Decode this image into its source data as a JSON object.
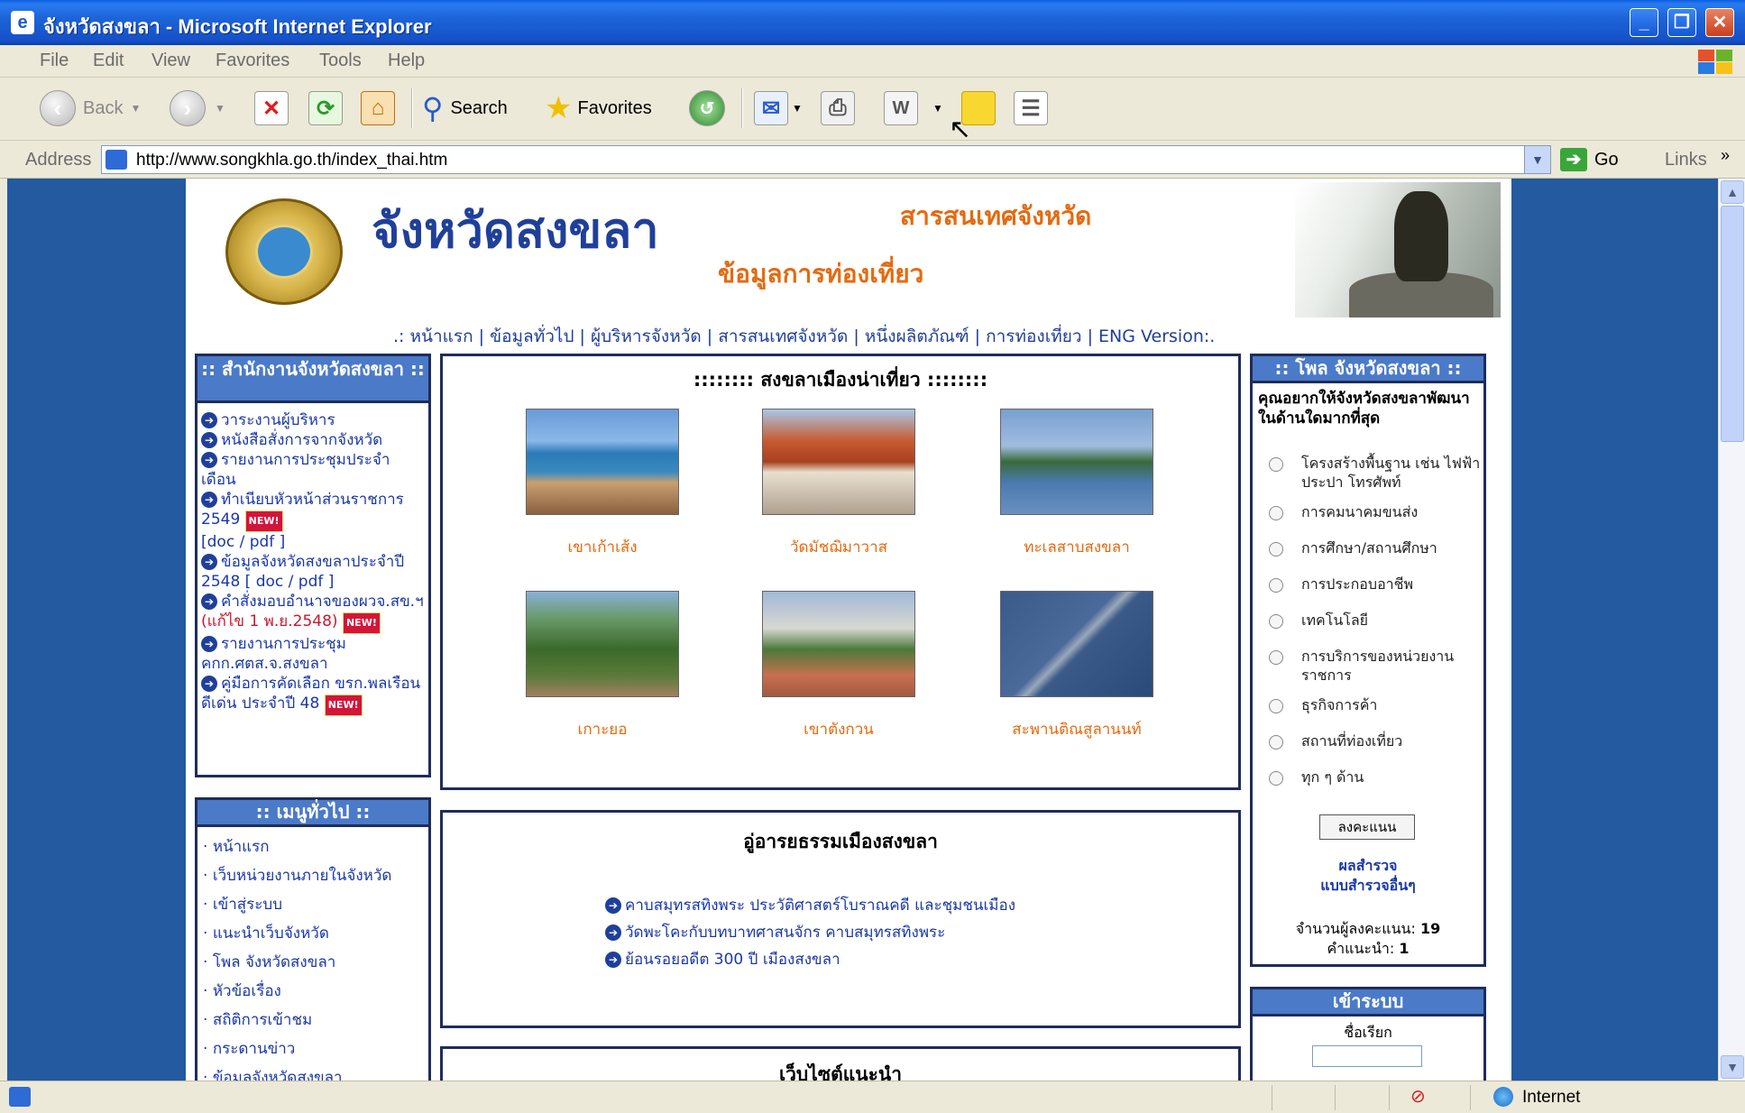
{
  "window": {
    "title": "จังหวัดสงขลา - Microsoft Internet Explorer"
  },
  "menu": [
    "File",
    "Edit",
    "View",
    "Favorites",
    "Tools",
    "Help"
  ],
  "toolbar": {
    "back_label": "Back",
    "search_label": "Search",
    "favorites_label": "Favorites"
  },
  "address": {
    "label": "Address",
    "url": "http://www.songkhla.go.th/index_thai.htm",
    "go_label": "Go",
    "links_label": "Links"
  },
  "header": {
    "site_title": "จังหวัดสงขลา",
    "subtitle1": "สารสนเทศจังหวัด",
    "subtitle2": "ข้อมูลการท่องเที่ยว"
  },
  "nav": {
    "prefix": ".:",
    "items": [
      "หน้าแรก",
      "ข้อมูลทั่วไป",
      "ผู้บริหารจังหวัด",
      "สารสนเทศจังหวัด",
      "หนึ่งผลิตภัณฑ์",
      "การท่องเที่ยว",
      "ENG Version"
    ],
    "suffix": ":."
  },
  "office_box": {
    "heading": ":: สำนักงานจังหวัดสงขลา ::",
    "links": [
      "วาระงานผู้บริหาร",
      "หนังสือสั่งการจากจังหวัด",
      "รายงานการประชุมประจำเดือน",
      "ทำเนียบหัวหน้าส่วนราชการ 2549",
      "[doc / pdf ]",
      "ข้อมูลจังหวัดสงขลาประจำปี 2548 [ doc / pdf ]",
      "คำสั่งมอบอำนาจของผวจ.สข.ฯ",
      "(แก้ไข 1 พ.ย.2548)",
      "รายงานการประชุม คกก.ศตส.จ.สงขลา",
      "คู่มือการคัดเลือก ขรก.พลเรือนดีเด่น ประจำปี 48"
    ],
    "new_badge": "NEW!"
  },
  "general_menu": {
    "heading": ":: เมนูทั่วไป ::",
    "items": [
      "หน้าแรก",
      "เว็บหน่วยงานภายในจังหวัด",
      "เข้าสู่ระบบ",
      "แนะนำเว็บจังหวัด",
      "โพล จังหวัดสงขลา",
      "หัวข้อเรื่อง",
      "สถิติการเข้าชม",
      "กระดานข่าว",
      "ข้อมูลจังหวัดสงขลา"
    ]
  },
  "tourism": {
    "heading": ":::::::: สงขลาเมืองน่าเที่ยว ::::::::",
    "places": [
      "เขาเก้าเส้ง",
      "วัดมัชฌิมาวาส",
      "ทะเลสาบสงขลา",
      "เกาะยอ",
      "เขาตังกวน",
      "สะพานติณสูลานนท์"
    ]
  },
  "culture": {
    "heading": "อู่อารยธรรมเมืองสงขลา",
    "links": [
      "คาบสมุทรสทิงพระ ประวัติศาสตร์โบราณคดี และชุมชนเมือง",
      "วัดพะโคะกับบทบาทศาสนจักร คาบสมุทรสทิงพระ",
      "ย้อนรอยอดีต 300 ปี เมืองสงขลา"
    ]
  },
  "recommended": {
    "heading": "เว็บไซต์แนะนำ"
  },
  "poll": {
    "heading": ":: โพล จังหวัดสงขลา ::",
    "question": "คุณอยากให้จังหวัดสงขลาพัฒนาในด้านใดมากที่สุด",
    "options": [
      "โครงสร้างพื้นฐาน เช่น ไฟฟ้า ประปา โทรศัพท์",
      "การคมนาคมขนส่ง",
      "การศึกษา/สถานศึกษา",
      "การประกอบอาชีพ",
      "เทคโนโลยี",
      "การบริการของหน่วยงานราชการ",
      "ธุรกิจการค้า",
      "สถานที่ท่องเที่ยว",
      "ทุก ๆ ด้าน"
    ],
    "vote_button": "ลงคะแนน",
    "results_link": "ผลสำรวจ",
    "other_link": "แบบสำรวจอื่นๆ",
    "voters_label": "จำนวนผู้ลงคะแนน:",
    "voters_count": "19",
    "comments_label": "คำแนะนำ:",
    "comments_count": "1"
  },
  "login": {
    "heading": "เข้าระบบ",
    "username_label": "ชื่อเรียก"
  },
  "status": {
    "zone": "Internet"
  }
}
